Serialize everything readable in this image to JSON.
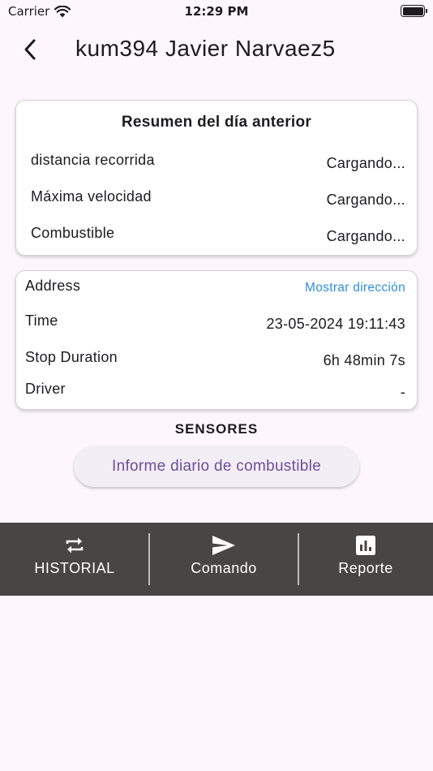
{
  "status_bar": {
    "carrier": "Carrier",
    "time": "12:29 PM"
  },
  "app_bar": {
    "title": "kum394 Javier Narvaez5",
    "back_icon": "chevron-left-icon"
  },
  "summary_card": {
    "title": "Resumen del día anterior",
    "rows": [
      {
        "label": "distancia recorrida",
        "value": "Cargando..."
      },
      {
        "label": "Máxima velocidad",
        "value": "Cargando..."
      },
      {
        "label": "Combustible",
        "value": "Cargando..."
      }
    ]
  },
  "info_card": {
    "rows": [
      {
        "label": "Address",
        "value": "Mostrar dirección"
      },
      {
        "label": "Time",
        "value": "23-05-2024 19:11:43"
      },
      {
        "label": "Stop Duration",
        "value": "6h 48min 7s"
      },
      {
        "label": "Driver",
        "value": "-"
      }
    ]
  },
  "sensors": {
    "title": "SENSORES",
    "button_label": "Informe diario de combustible"
  },
  "bottom_nav": {
    "items": [
      {
        "label": "HISTORIAL",
        "icon": "repeat-icon"
      },
      {
        "label": "Comando",
        "icon": "send-icon"
      },
      {
        "label": "Reporte",
        "icon": "bar-chart-icon"
      }
    ]
  },
  "colors": {
    "background": "#fdf7fd",
    "link": "#2f8fdd",
    "button_text": "#6a4f9b",
    "button_bg": "#f3edf6",
    "nav_bg": "#474644"
  }
}
